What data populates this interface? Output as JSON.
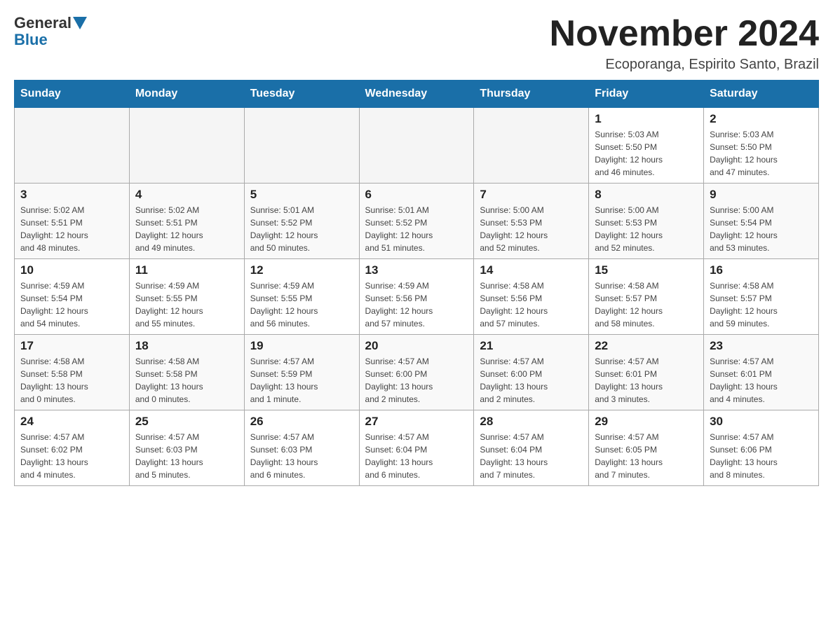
{
  "header": {
    "logo_general": "General",
    "logo_blue": "Blue",
    "month_title": "November 2024",
    "location": "Ecoporanga, Espirito Santo, Brazil"
  },
  "days_of_week": [
    "Sunday",
    "Monday",
    "Tuesday",
    "Wednesday",
    "Thursday",
    "Friday",
    "Saturday"
  ],
  "weeks": [
    [
      {
        "day": "",
        "info": ""
      },
      {
        "day": "",
        "info": ""
      },
      {
        "day": "",
        "info": ""
      },
      {
        "day": "",
        "info": ""
      },
      {
        "day": "",
        "info": ""
      },
      {
        "day": "1",
        "info": "Sunrise: 5:03 AM\nSunset: 5:50 PM\nDaylight: 12 hours\nand 46 minutes."
      },
      {
        "day": "2",
        "info": "Sunrise: 5:03 AM\nSunset: 5:50 PM\nDaylight: 12 hours\nand 47 minutes."
      }
    ],
    [
      {
        "day": "3",
        "info": "Sunrise: 5:02 AM\nSunset: 5:51 PM\nDaylight: 12 hours\nand 48 minutes."
      },
      {
        "day": "4",
        "info": "Sunrise: 5:02 AM\nSunset: 5:51 PM\nDaylight: 12 hours\nand 49 minutes."
      },
      {
        "day": "5",
        "info": "Sunrise: 5:01 AM\nSunset: 5:52 PM\nDaylight: 12 hours\nand 50 minutes."
      },
      {
        "day": "6",
        "info": "Sunrise: 5:01 AM\nSunset: 5:52 PM\nDaylight: 12 hours\nand 51 minutes."
      },
      {
        "day": "7",
        "info": "Sunrise: 5:00 AM\nSunset: 5:53 PM\nDaylight: 12 hours\nand 52 minutes."
      },
      {
        "day": "8",
        "info": "Sunrise: 5:00 AM\nSunset: 5:53 PM\nDaylight: 12 hours\nand 52 minutes."
      },
      {
        "day": "9",
        "info": "Sunrise: 5:00 AM\nSunset: 5:54 PM\nDaylight: 12 hours\nand 53 minutes."
      }
    ],
    [
      {
        "day": "10",
        "info": "Sunrise: 4:59 AM\nSunset: 5:54 PM\nDaylight: 12 hours\nand 54 minutes."
      },
      {
        "day": "11",
        "info": "Sunrise: 4:59 AM\nSunset: 5:55 PM\nDaylight: 12 hours\nand 55 minutes."
      },
      {
        "day": "12",
        "info": "Sunrise: 4:59 AM\nSunset: 5:55 PM\nDaylight: 12 hours\nand 56 minutes."
      },
      {
        "day": "13",
        "info": "Sunrise: 4:59 AM\nSunset: 5:56 PM\nDaylight: 12 hours\nand 57 minutes."
      },
      {
        "day": "14",
        "info": "Sunrise: 4:58 AM\nSunset: 5:56 PM\nDaylight: 12 hours\nand 57 minutes."
      },
      {
        "day": "15",
        "info": "Sunrise: 4:58 AM\nSunset: 5:57 PM\nDaylight: 12 hours\nand 58 minutes."
      },
      {
        "day": "16",
        "info": "Sunrise: 4:58 AM\nSunset: 5:57 PM\nDaylight: 12 hours\nand 59 minutes."
      }
    ],
    [
      {
        "day": "17",
        "info": "Sunrise: 4:58 AM\nSunset: 5:58 PM\nDaylight: 13 hours\nand 0 minutes."
      },
      {
        "day": "18",
        "info": "Sunrise: 4:58 AM\nSunset: 5:58 PM\nDaylight: 13 hours\nand 0 minutes."
      },
      {
        "day": "19",
        "info": "Sunrise: 4:57 AM\nSunset: 5:59 PM\nDaylight: 13 hours\nand 1 minute."
      },
      {
        "day": "20",
        "info": "Sunrise: 4:57 AM\nSunset: 6:00 PM\nDaylight: 13 hours\nand 2 minutes."
      },
      {
        "day": "21",
        "info": "Sunrise: 4:57 AM\nSunset: 6:00 PM\nDaylight: 13 hours\nand 2 minutes."
      },
      {
        "day": "22",
        "info": "Sunrise: 4:57 AM\nSunset: 6:01 PM\nDaylight: 13 hours\nand 3 minutes."
      },
      {
        "day": "23",
        "info": "Sunrise: 4:57 AM\nSunset: 6:01 PM\nDaylight: 13 hours\nand 4 minutes."
      }
    ],
    [
      {
        "day": "24",
        "info": "Sunrise: 4:57 AM\nSunset: 6:02 PM\nDaylight: 13 hours\nand 4 minutes."
      },
      {
        "day": "25",
        "info": "Sunrise: 4:57 AM\nSunset: 6:03 PM\nDaylight: 13 hours\nand 5 minutes."
      },
      {
        "day": "26",
        "info": "Sunrise: 4:57 AM\nSunset: 6:03 PM\nDaylight: 13 hours\nand 6 minutes."
      },
      {
        "day": "27",
        "info": "Sunrise: 4:57 AM\nSunset: 6:04 PM\nDaylight: 13 hours\nand 6 minutes."
      },
      {
        "day": "28",
        "info": "Sunrise: 4:57 AM\nSunset: 6:04 PM\nDaylight: 13 hours\nand 7 minutes."
      },
      {
        "day": "29",
        "info": "Sunrise: 4:57 AM\nSunset: 6:05 PM\nDaylight: 13 hours\nand 7 minutes."
      },
      {
        "day": "30",
        "info": "Sunrise: 4:57 AM\nSunset: 6:06 PM\nDaylight: 13 hours\nand 8 minutes."
      }
    ]
  ]
}
